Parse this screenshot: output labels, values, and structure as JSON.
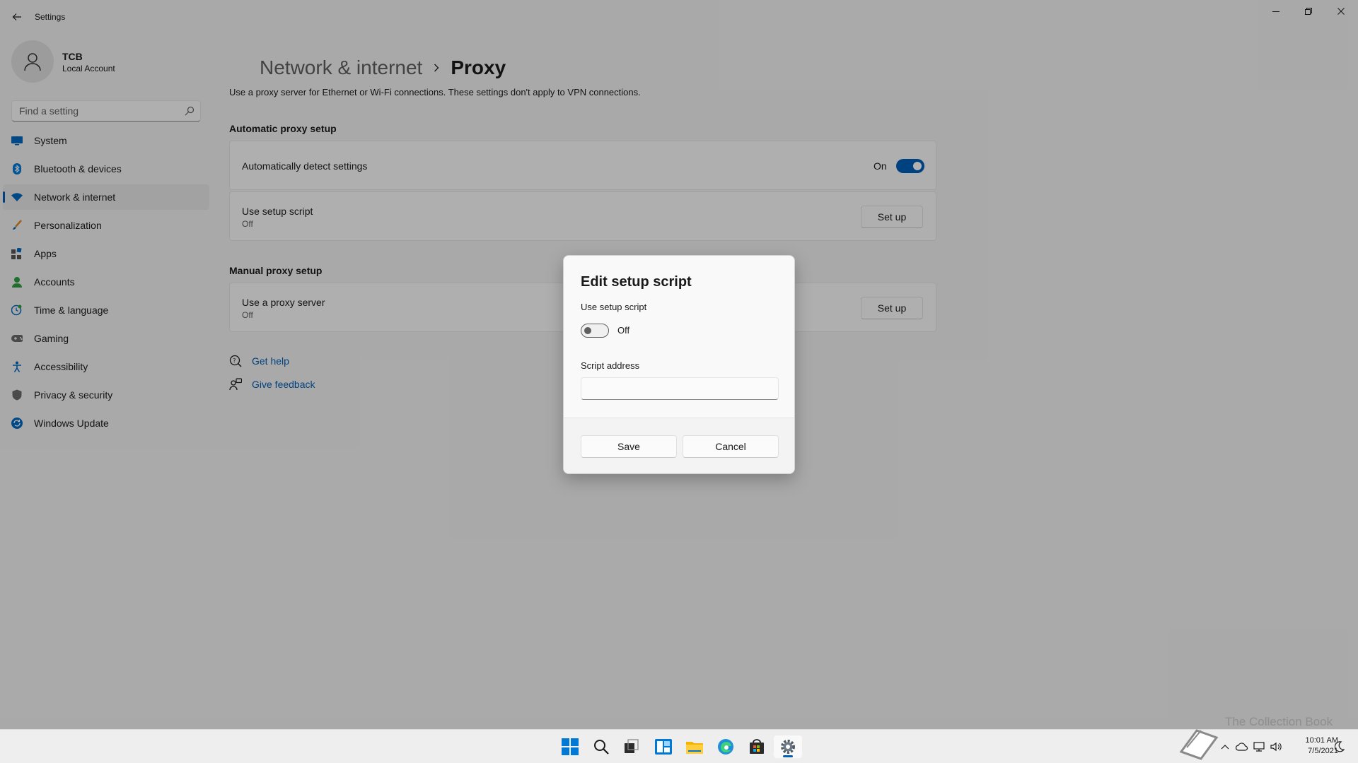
{
  "app": {
    "title": "Settings"
  },
  "profile": {
    "name": "TCB",
    "account_type": "Local Account"
  },
  "search": {
    "placeholder": "Find a setting"
  },
  "sidebar": {
    "items": [
      {
        "label": "System",
        "icon": "monitor-icon"
      },
      {
        "label": "Bluetooth & devices",
        "icon": "bluetooth-icon"
      },
      {
        "label": "Network & internet",
        "icon": "wifi-icon",
        "active": true
      },
      {
        "label": "Personalization",
        "icon": "brush-icon"
      },
      {
        "label": "Apps",
        "icon": "apps-icon"
      },
      {
        "label": "Accounts",
        "icon": "person-icon"
      },
      {
        "label": "Time & language",
        "icon": "globe-clock-icon"
      },
      {
        "label": "Gaming",
        "icon": "gamepad-icon"
      },
      {
        "label": "Accessibility",
        "icon": "accessibility-icon"
      },
      {
        "label": "Privacy & security",
        "icon": "shield-icon"
      },
      {
        "label": "Windows Update",
        "icon": "update-icon"
      }
    ]
  },
  "breadcrumb": {
    "parent": "Network & internet",
    "current": "Proxy"
  },
  "page": {
    "description": "Use a proxy server for Ethernet or Wi-Fi connections. These settings don't apply to VPN connections."
  },
  "automatic": {
    "title": "Automatic proxy setup",
    "detect": {
      "label": "Automatically detect settings",
      "state": "On"
    },
    "script": {
      "label": "Use setup script",
      "state": "Off",
      "button": "Set up"
    }
  },
  "manual": {
    "title": "Manual proxy setup",
    "proxy": {
      "label": "Use a proxy server",
      "state": "Off",
      "button": "Set up"
    }
  },
  "links": {
    "help": "Get help",
    "feedback": "Give feedback"
  },
  "dialog": {
    "title": "Edit setup script",
    "toggle_label": "Use setup script",
    "toggle_state": "Off",
    "address_label": "Script address",
    "address_value": "",
    "save": "Save",
    "cancel": "Cancel"
  },
  "taskbar": {
    "clock_time": "10:01 AM",
    "clock_date": "7/5/2021"
  },
  "watermark": "The Collection Book",
  "colors": {
    "accent": "#005fb8",
    "background": "#f3f3f3",
    "card": "#fbfbfb"
  }
}
